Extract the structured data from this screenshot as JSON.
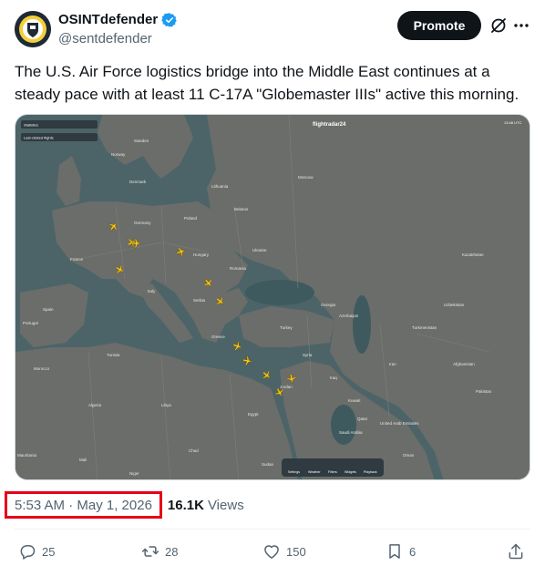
{
  "author": {
    "display_name": "OSINTdefender",
    "handle": "@sentdefender",
    "verified": true,
    "avatar_icon": "avatar-logo-icon"
  },
  "header": {
    "promote_label": "Promote",
    "grok_icon": "grok-icon",
    "more_icon": "more-icon"
  },
  "tweet": {
    "text": "The U.S. Air Force logistics bridge into the Middle East continues at a steady pace with at least 11 C-17A \"Globemaster IIIs\" active this morning."
  },
  "media": {
    "brand": "flightradar24",
    "time": "13:48 UTC",
    "panel_title": "Statistics",
    "panel_filter": "Last-clicked flights",
    "controls": [
      "Settings",
      "Weather",
      "Filters",
      "Widgets",
      "Playback"
    ],
    "map_labels": [
      "Sweden",
      "Norway",
      "Denmark",
      "Lithuania",
      "Belarus",
      "Poland",
      "Germany",
      "Ukraine",
      "Hungary",
      "Romania",
      "France",
      "Italy",
      "Spain",
      "Portugal",
      "Algeria",
      "Libya",
      "Egypt",
      "Turkey",
      "Syria",
      "Iraq",
      "Iran",
      "Saudi Arabia",
      "Kazakhstan",
      "Uzbekistan",
      "Turkmenistan",
      "Afghanistan",
      "Pakistan",
      "Oman",
      "Sudan",
      "Morocco",
      "Mauritania",
      "Mali",
      "Niger",
      "Tunisia",
      "Greece",
      "Serbia",
      "Moscow",
      "Jordan",
      "Kuwait",
      "Qatar",
      "United Arab Emirates",
      "Yemen",
      "Chad",
      "Azerbaijan",
      "Georgia"
    ]
  },
  "meta": {
    "timestamp": "5:53 AM · May 1, 2026",
    "views_count": "16.1K",
    "views_label": "Views",
    "highlight_color": "#e5001a"
  },
  "actions": {
    "replies": "25",
    "reposts": "28",
    "likes": "150",
    "bookmarks": "6"
  }
}
